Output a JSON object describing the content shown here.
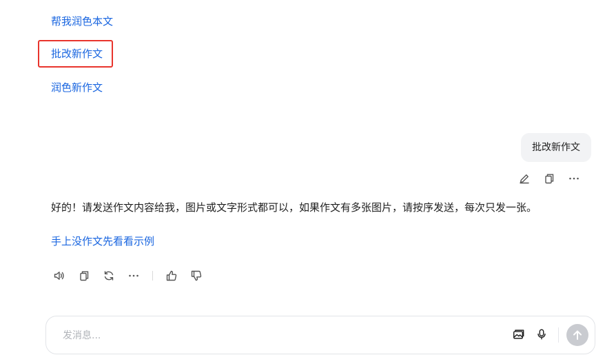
{
  "suggestions": [
    {
      "label": "帮我润色本文"
    },
    {
      "label": "批改新作文"
    },
    {
      "label": "润色新作文"
    }
  ],
  "user_message": {
    "text": "批改新作文",
    "actions": [
      "edit-icon",
      "copy-icon",
      "more-icon"
    ]
  },
  "bot_message": {
    "text": "好的！请发送作文内容给我，图片或文字形式都可以，如果作文有多张图片，请按序发送，每次只发一张。",
    "link": "手上没作文先看看示例",
    "actions": [
      "speaker-icon",
      "copy-icon",
      "regenerate-icon",
      "more-icon",
      "thumbs-up-icon",
      "thumbs-down-icon"
    ]
  },
  "composer": {
    "placeholder": "发消息..."
  },
  "colors": {
    "link": "#1a66e0",
    "highlight": "#e8342c",
    "bubble_bg": "#f2f3f5",
    "send_disabled": "#c9cbd0"
  }
}
